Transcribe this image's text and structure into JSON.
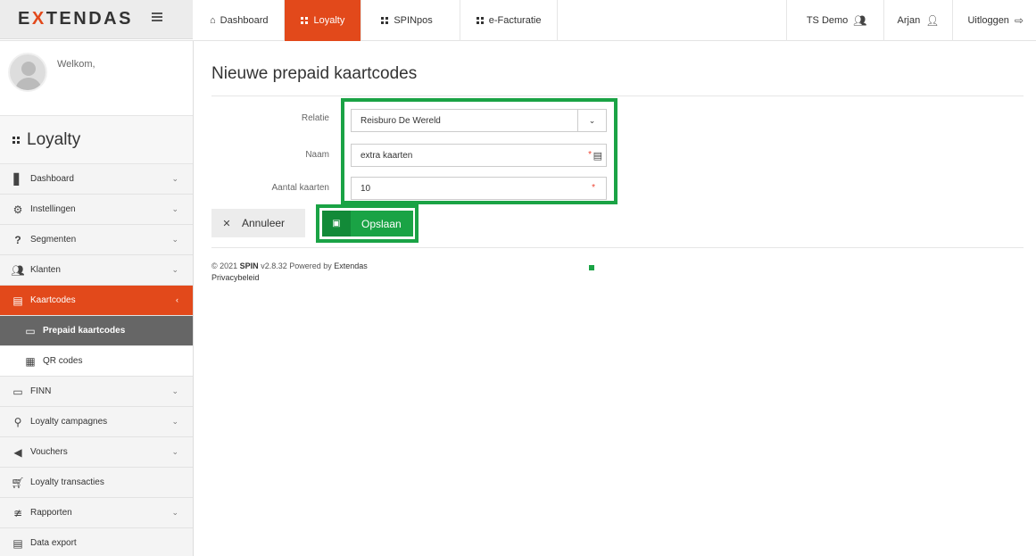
{
  "brand": {
    "name_pre": "E",
    "name_x": "X",
    "name_post": "TENDAS"
  },
  "topnav": [
    {
      "label": "Dashboard",
      "icon": "home-icon",
      "active": false
    },
    {
      "label": "Loyalty",
      "icon": "grid-icon",
      "active": true
    },
    {
      "label": "SPINpos",
      "icon": "grid-icon",
      "active": false
    },
    {
      "label": "e-Facturatie",
      "icon": "grid-icon",
      "active": false
    }
  ],
  "topnav_right": {
    "org": "TS Demo",
    "user": "Arjan",
    "logout": "Uitloggen"
  },
  "sidebar": {
    "welcome": "Welkom,",
    "module": "Loyalty",
    "items": [
      {
        "label": "Dashboard",
        "icon": "bar-chart-icon"
      },
      {
        "label": "Instellingen",
        "icon": "gear-icon"
      },
      {
        "label": "Segmenten",
        "icon": "question-icon"
      },
      {
        "label": "Klanten",
        "icon": "users-icon"
      },
      {
        "label": "Kaartcodes",
        "icon": "id-card-icon"
      },
      {
        "label": "Prepaid kaartcodes",
        "icon": "credit-card-icon"
      },
      {
        "label": "QR codes",
        "icon": "qr-code-icon"
      },
      {
        "label": "FINN",
        "icon": "credit-card-icon"
      },
      {
        "label": "Loyalty campagnes",
        "icon": "trophy-icon"
      },
      {
        "label": "Vouchers",
        "icon": "megaphone-icon"
      },
      {
        "label": "Loyalty transacties",
        "icon": "cart-icon"
      },
      {
        "label": "Rapporten",
        "icon": "line-chart-icon"
      },
      {
        "label": "Data export",
        "icon": "document-icon"
      }
    ]
  },
  "main": {
    "title": "Nieuwe prepaid kaartcodes",
    "form": {
      "relatie_label": "Relatie",
      "relatie_value": "Reisburo De Wereld",
      "naam_label": "Naam",
      "naam_value": "extra kaarten",
      "aantal_label": "Aantal kaarten",
      "aantal_value": "10",
      "required_mark": "*"
    },
    "buttons": {
      "cancel": "Annuleer",
      "save": "Opslaan"
    },
    "footer": {
      "copyright": "© 2021",
      "product": "SPIN",
      "version": "v2.8.32 Powered by",
      "vendor": "Extendas",
      "privacy": "Privacybeleid"
    }
  },
  "colors": {
    "accent": "#e2491b",
    "success": "#1aa345",
    "submenu_active": "#666666"
  }
}
